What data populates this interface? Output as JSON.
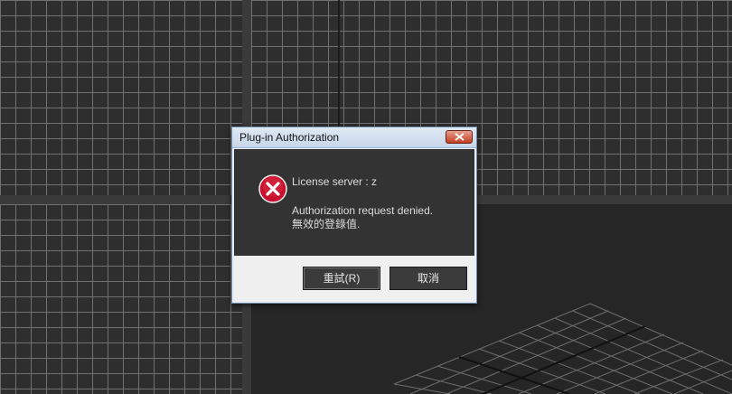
{
  "dialog": {
    "title": "Plug-in Authorization",
    "close_icon": "close-icon",
    "status_icon": "error-icon",
    "message_server": "License server : z",
    "message_denied": "Authorization request denied.",
    "message_invalid": "無效的登錄值.",
    "buttons": {
      "retry_label": "重試(R)",
      "cancel_label": "取消"
    }
  },
  "colors": {
    "viewport_bg": "#2e2e2e",
    "grid_line": "#707070",
    "dialog_body_bg": "#333333",
    "close_button": "#c33c21",
    "error_icon": "#c8102e"
  }
}
